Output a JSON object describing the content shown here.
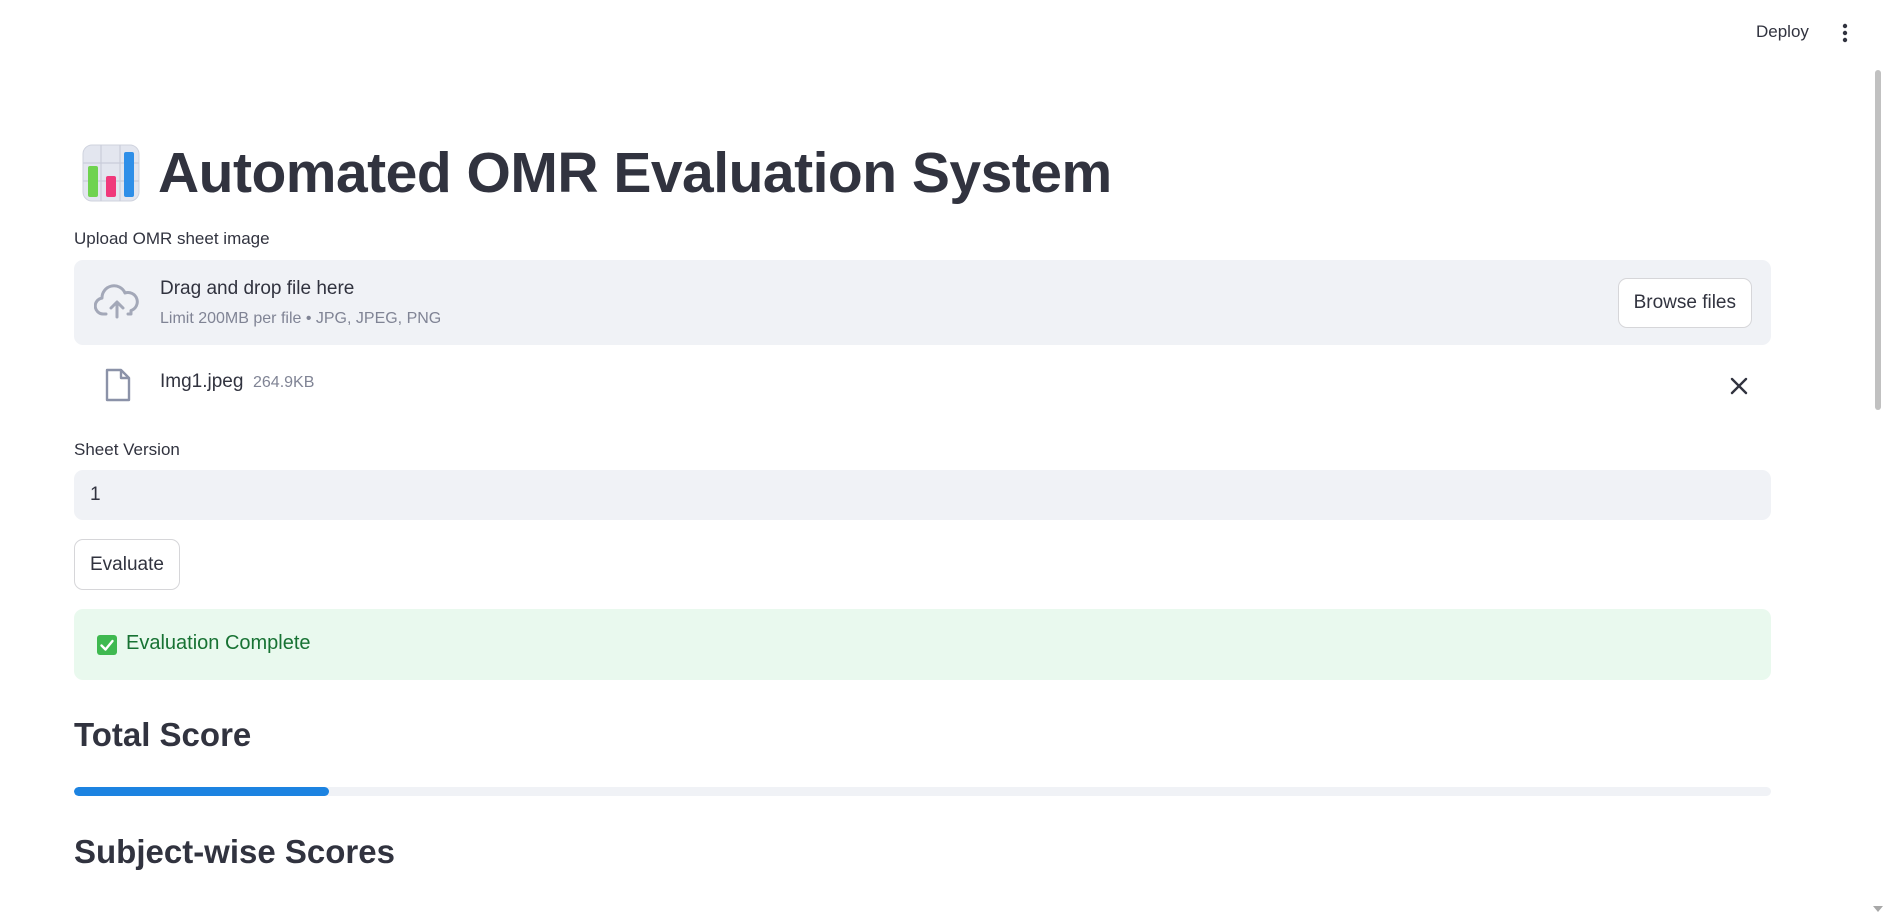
{
  "header": {
    "deploy_label": "Deploy",
    "menu_icon": "vertical-ellipsis-icon"
  },
  "page": {
    "title_icon": "bar-chart-emoji-icon",
    "title": "Automated OMR Evaluation System"
  },
  "uploader": {
    "label": "Upload OMR sheet image",
    "dropzone_text": "Drag and drop file here",
    "dropzone_hint": "Limit 200MB per file • JPG, JPEG, PNG",
    "browse_label": "Browse files",
    "upload_icon": "cloud-upload-icon",
    "file": {
      "icon": "file-icon",
      "name": "Img1.jpeg",
      "size": "264.9KB",
      "remove_icon": "close-icon"
    }
  },
  "sheet_version": {
    "label": "Sheet Version",
    "value": "1"
  },
  "actions": {
    "evaluate_label": "Evaluate"
  },
  "status": {
    "icon": "check-box-icon",
    "message": "Evaluation Complete",
    "color": "#177233",
    "background": "#e9f9ee"
  },
  "results": {
    "total_heading": "Total Score",
    "total_progress": 0.15,
    "progress_color": "#1c83e1",
    "subject_heading": "Subject-wise Scores"
  }
}
